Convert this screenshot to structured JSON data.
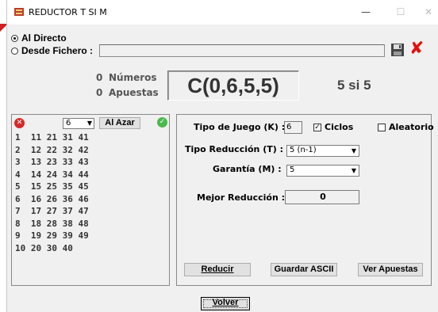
{
  "window": {
    "title": "REDUCTOR T SI M",
    "minimize": "—",
    "maximize": "☐",
    "close": "✕"
  },
  "source": {
    "options": [
      {
        "label": "Al Directo",
        "selected": true
      },
      {
        "label": "Desde Fichero :",
        "selected": false
      }
    ],
    "file_value": ""
  },
  "stats": {
    "numeros_count": "0",
    "numeros_label": "Números",
    "apuestas_count": "0",
    "apuestas_label": "Apuestas"
  },
  "combination": "C(0,6,5,5)",
  "ratio": "5 si 5",
  "numbers_panel": {
    "count_select": "6",
    "random_label": "Al Azar",
    "rows": [
      "1  11 21 31 41",
      "2  12 22 32 42",
      "3  13 23 33 43",
      "4  14 24 34 44",
      "5  15 25 35 45",
      "6  16 26 36 46",
      "7  17 27 37 47",
      "8  18 28 38 48",
      "9  19 29 39 49",
      "10 20 30 40"
    ]
  },
  "settings": {
    "tipo_juego_label": "Tipo de Juego (K) :",
    "tipo_juego_value": "6",
    "ciclos_label": "Ciclos",
    "ciclos_checked": true,
    "aleatorio_label": "Aleatorio",
    "aleatorio_checked": false,
    "tipo_reduccion_label": "Tipo Reducción (T) :",
    "tipo_reduccion_value": "5 (n-1)",
    "garantia_label": "Garantía (M) :",
    "garantia_value": "5",
    "mejor_label": "Mejor Reducción :",
    "mejor_value": "0"
  },
  "actions": {
    "reducir": "Reducir",
    "guardar": "Guardar ASCII",
    "ver": "Ver Apuestas",
    "volver": "Volver"
  },
  "colors": {
    "window_bg": "#f0f0f0",
    "delete_red": "#e41010",
    "check_green": "#4cb94c"
  }
}
